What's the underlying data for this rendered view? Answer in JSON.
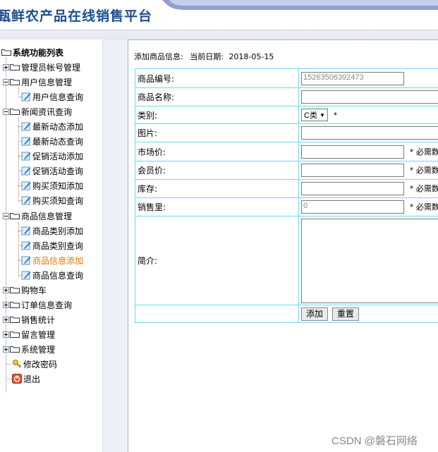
{
  "header": {
    "title": "甄鲜农产品在线销售平台"
  },
  "sidebar": {
    "title": "系统功能列表",
    "items": [
      {
        "label": "管理员帐号管理",
        "kind": "folder",
        "state": "plus"
      },
      {
        "label": "用户信息管理",
        "kind": "folder",
        "state": "minus"
      },
      {
        "label": "用户信息查询",
        "kind": "leaf"
      },
      {
        "label": "新闻资讯查询",
        "kind": "folder",
        "state": "minus"
      },
      {
        "label": "最新动态添加",
        "kind": "leaf"
      },
      {
        "label": "最新动态查询",
        "kind": "leaf"
      },
      {
        "label": "促销活动添加",
        "kind": "leaf"
      },
      {
        "label": "促销活动查询",
        "kind": "leaf"
      },
      {
        "label": "购买须知添加",
        "kind": "leaf"
      },
      {
        "label": "购买须知查询",
        "kind": "leaf"
      },
      {
        "label": "商品信息管理",
        "kind": "folder",
        "state": "minus"
      },
      {
        "label": "商品类别添加",
        "kind": "leaf"
      },
      {
        "label": "商品类别查询",
        "kind": "leaf"
      },
      {
        "label": "商品信息添加",
        "kind": "leaf",
        "active": true
      },
      {
        "label": "商品信息查询",
        "kind": "leaf"
      },
      {
        "label": "购物车",
        "kind": "folder",
        "state": "plus"
      },
      {
        "label": "订单信息查询",
        "kind": "folder",
        "state": "plus"
      },
      {
        "label": "销售统计",
        "kind": "folder",
        "state": "plus"
      },
      {
        "label": "留言管理",
        "kind": "folder",
        "state": "plus"
      },
      {
        "label": "系统管理",
        "kind": "folder",
        "state": "plus"
      },
      {
        "label": "修改密码",
        "kind": "key"
      },
      {
        "label": "退出",
        "kind": "exit"
      }
    ]
  },
  "main": {
    "info_label": "添加商品信息:",
    "date_label": "当前日期:",
    "date_value": "2018-05-15",
    "form": {
      "code_label": "商品编号:",
      "code_value": "15263506392473",
      "name_label": "商品名称:",
      "name_value": "",
      "category_label": "类别:",
      "category_value": "C类",
      "category_req": "*",
      "image_label": "图片:",
      "image_value": "",
      "market_label": "市场价:",
      "market_value": "",
      "market_req": "* 必需数",
      "member_label": "会员价:",
      "member_value": "",
      "member_req": "* 必需数",
      "stock_label": "库存:",
      "stock_value": "",
      "stock_req": "* 必需数",
      "sales_label": "销售里:",
      "sales_value": "0",
      "sales_req": "* 必需数",
      "intro_label": "简介:",
      "add_button": "添加",
      "reset_button": "重置"
    }
  },
  "watermark": "CSDN @磐石网络",
  "colors": {
    "accent": "#1d4e8f",
    "active": "#e07800",
    "table_border": "#6fd8e8"
  }
}
